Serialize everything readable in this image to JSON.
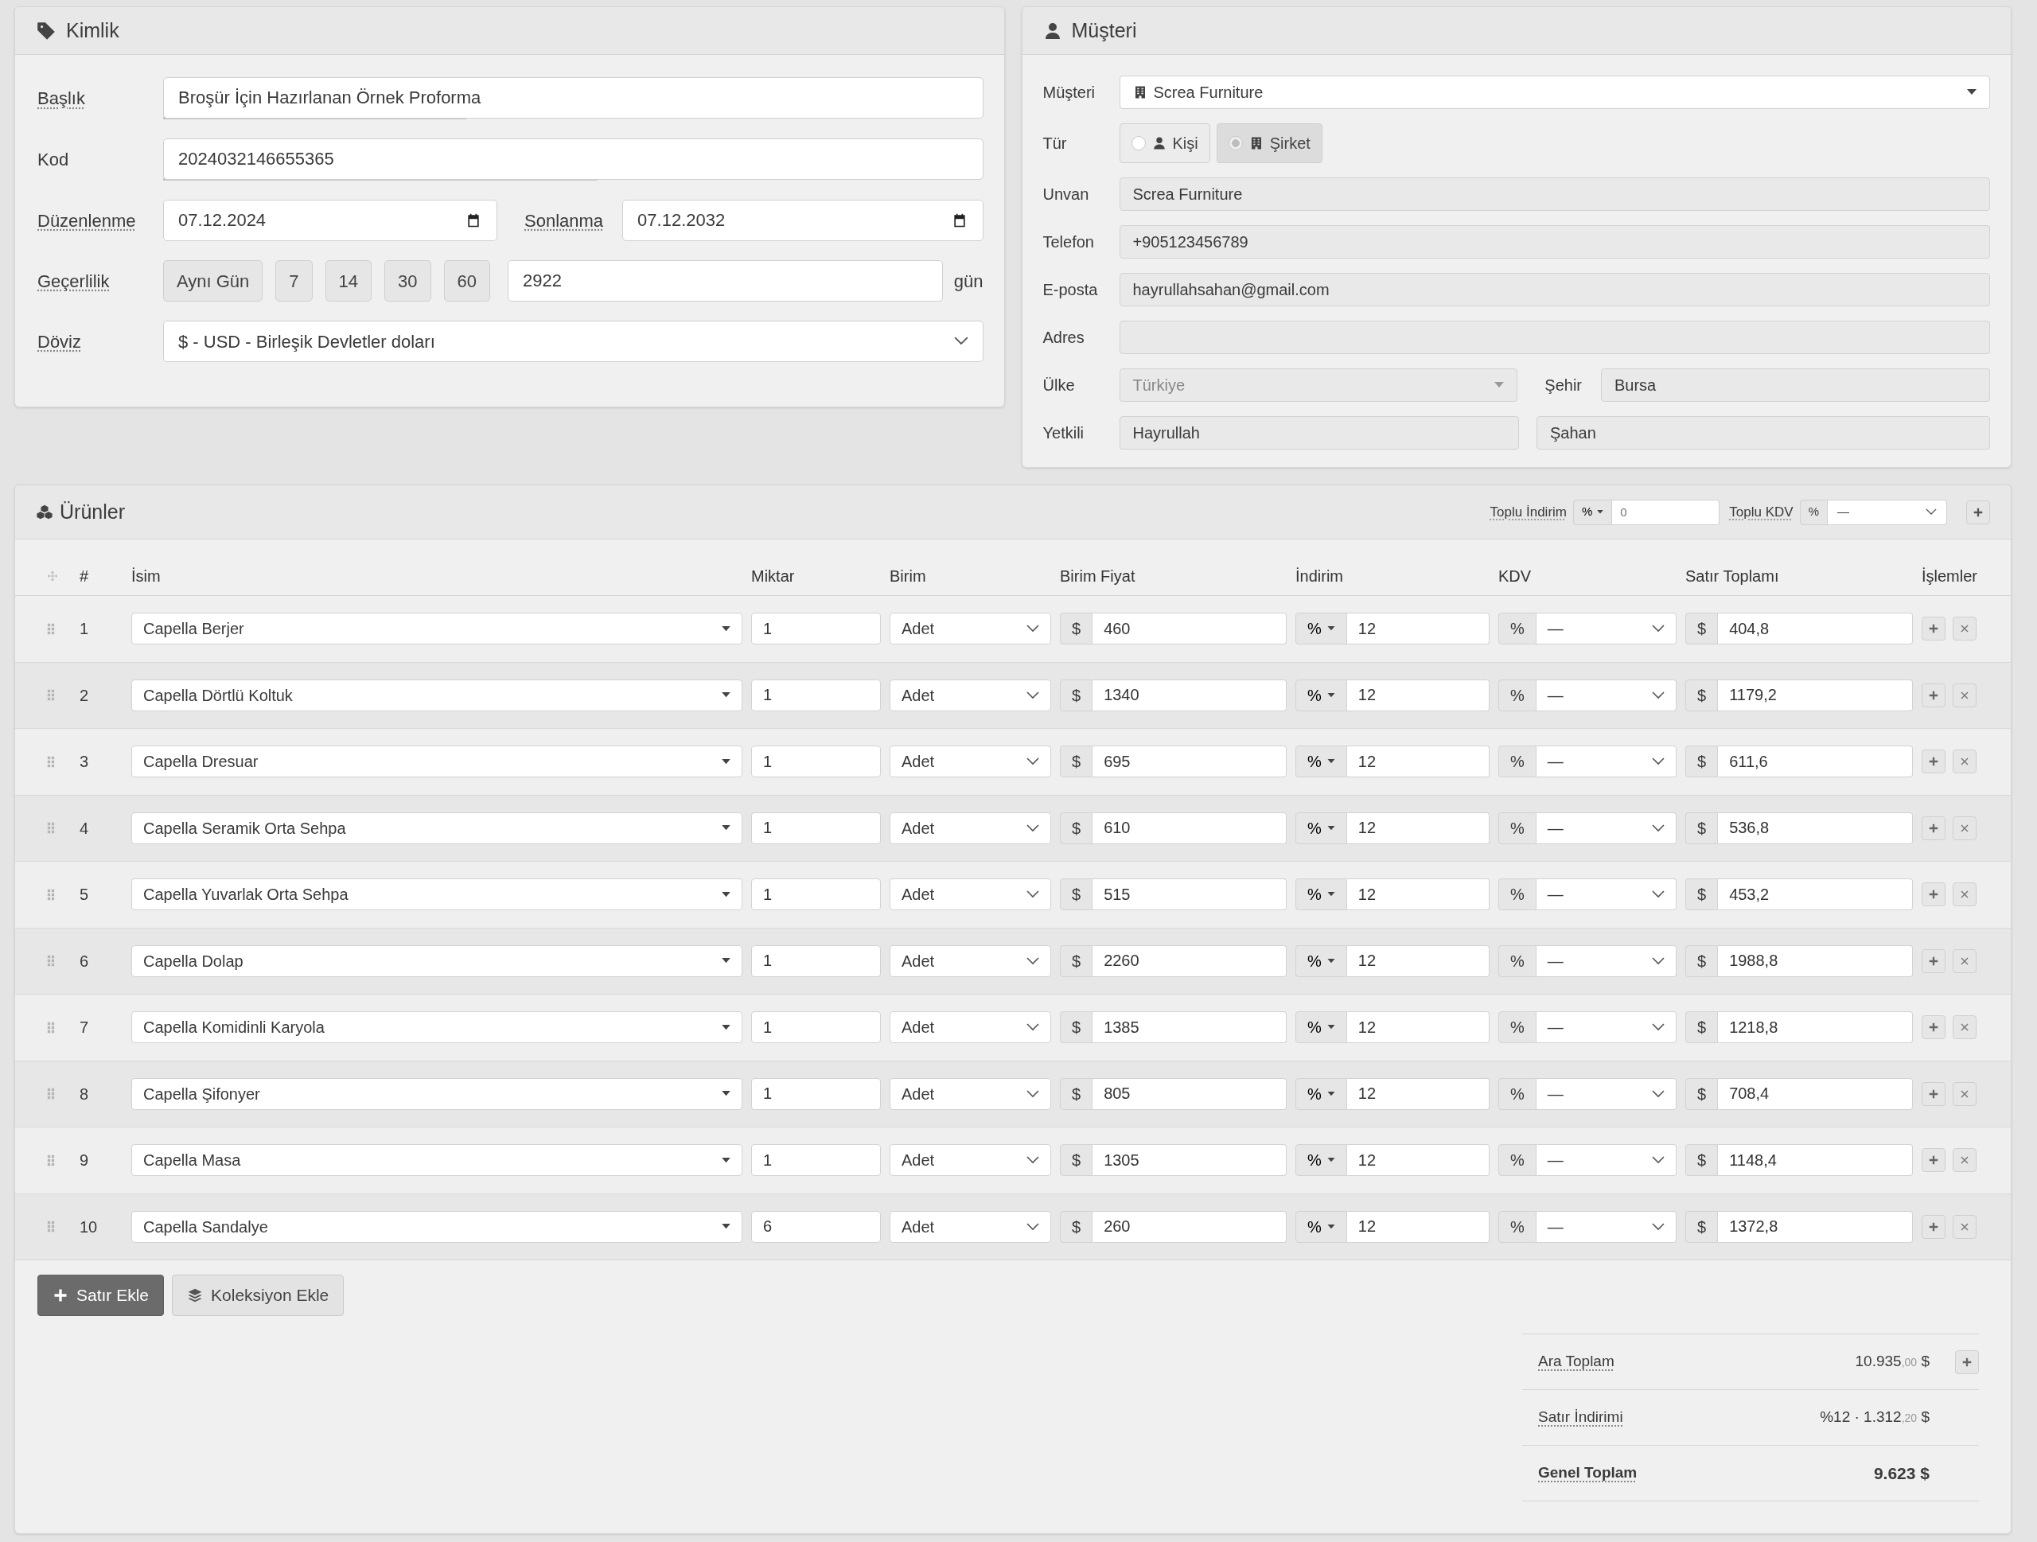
{
  "kimlik": {
    "title": "Kimlik",
    "title_field": {
      "label": "Başlık",
      "tooltip": true,
      "value": "Broşür İçin Hazırlanan Örnek Proforma",
      "level": 0.37
    },
    "code": {
      "label": "Kod",
      "tooltip": false,
      "value": "2024032146655365",
      "level": 0.53
    },
    "issue_date": {
      "label": "Düzenlenme",
      "tooltip": true,
      "value": "07.12.2024"
    },
    "expiry_date": {
      "label": "Sonlanma",
      "tooltip": true,
      "value": "07.12.2032"
    },
    "validity": {
      "label": "Geçerlilik",
      "tooltip": true,
      "presets": [
        "Aynı Gün",
        "7",
        "14",
        "30",
        "60"
      ],
      "value": "2922",
      "unit": "gün"
    },
    "currency": {
      "label": "Döviz",
      "tooltip": true,
      "value": "$ - USD - Birleşik Devletler doları"
    }
  },
  "customer": {
    "title": "Müşteri",
    "customer": {
      "label": "Müşteri",
      "value": "Screa Furniture"
    },
    "type": {
      "label": "Tür",
      "options": [
        {
          "label": "Kişi",
          "kind": "person",
          "selected": false
        },
        {
          "label": "Şirket",
          "kind": "company",
          "selected": true
        }
      ]
    },
    "fields": [
      {
        "label": "Unvan",
        "value": "Screa Furniture"
      },
      {
        "label": "Telefon",
        "value": "+905123456789"
      },
      {
        "label": "E-posta",
        "value": "hayrullahsahan@gmail.com"
      },
      {
        "label": "Adres"
      }
    ],
    "country": {
      "label": "Ülke",
      "value": "Türkiye"
    },
    "city": {
      "label": "Şehir",
      "value": "Bursa"
    },
    "contact": {
      "label": "Yetkili",
      "first_name": "Hayrullah",
      "last_name": "Şahan"
    }
  },
  "products": {
    "title": "Ürünler",
    "bulk_discount": {
      "label": "Toplu İndirim",
      "type": "%",
      "placeholder": "0"
    },
    "bulk_vat": {
      "label": "Toplu KDV",
      "unit": "%",
      "value": "—"
    },
    "columns": [
      "#",
      "İsim",
      "Miktar",
      "Birim",
      "Birim Fiyat",
      "İndirim",
      "KDV",
      "Satır Toplamı",
      "İşlemler"
    ],
    "rows": [
      {
        "no": "1",
        "name": "Capella Berjer",
        "qty": "1",
        "unit": "Adet",
        "currency": "$",
        "price": "460",
        "discount_type": "%",
        "discount": "12",
        "vat_unit": "%",
        "vat": "—",
        "total_currency": "$",
        "total": "404,8"
      },
      {
        "no": "2",
        "name": "Capella Dörtlü Koltuk",
        "qty": "1",
        "unit": "Adet",
        "currency": "$",
        "price": "1340",
        "discount_type": "%",
        "discount": "12",
        "vat_unit": "%",
        "vat": "—",
        "total_currency": "$",
        "total": "1179,2"
      },
      {
        "no": "3",
        "name": "Capella Dresuar",
        "qty": "1",
        "unit": "Adet",
        "currency": "$",
        "price": "695",
        "discount_type": "%",
        "discount": "12",
        "vat_unit": "%",
        "vat": "—",
        "total_currency": "$",
        "total": "611,6"
      },
      {
        "no": "4",
        "name": "Capella Seramik Orta Sehpa",
        "qty": "1",
        "unit": "Adet",
        "currency": "$",
        "price": "610",
        "discount_type": "%",
        "discount": "12",
        "vat_unit": "%",
        "vat": "—",
        "total_currency": "$",
        "total": "536,8"
      },
      {
        "no": "5",
        "name": "Capella Yuvarlak Orta Sehpa",
        "qty": "1",
        "unit": "Adet",
        "currency": "$",
        "price": "515",
        "discount_type": "%",
        "discount": "12",
        "vat_unit": "%",
        "vat": "—",
        "total_currency": "$",
        "total": "453,2"
      },
      {
        "no": "6",
        "name": "Capella Dolap",
        "qty": "1",
        "unit": "Adet",
        "currency": "$",
        "price": "2260",
        "discount_type": "%",
        "discount": "12",
        "vat_unit": "%",
        "vat": "—",
        "total_currency": "$",
        "total": "1988,8"
      },
      {
        "no": "7",
        "name": "Capella Komidinli Karyola",
        "qty": "1",
        "unit": "Adet",
        "currency": "$",
        "price": "1385",
        "discount_type": "%",
        "discount": "12",
        "vat_unit": "%",
        "vat": "—",
        "total_currency": "$",
        "total": "1218,8"
      },
      {
        "no": "8",
        "name": "Capella Şifonyer",
        "qty": "1",
        "unit": "Adet",
        "currency": "$",
        "price": "805",
        "discount_type": "%",
        "discount": "12",
        "vat_unit": "%",
        "vat": "—",
        "total_currency": "$",
        "total": "708,4"
      },
      {
        "no": "9",
        "name": "Capella Masa",
        "qty": "1",
        "unit": "Adet",
        "currency": "$",
        "price": "1305",
        "discount_type": "%",
        "discount": "12",
        "vat_unit": "%",
        "vat": "—",
        "total_currency": "$",
        "total": "1148,4"
      },
      {
        "no": "10",
        "name": "Capella Sandalye",
        "qty": "6",
        "unit": "Adet",
        "currency": "$",
        "price": "260",
        "discount_type": "%",
        "discount": "12",
        "vat_unit": "%",
        "vat": "—",
        "total_currency": "$",
        "total": "1372,8"
      }
    ],
    "buttons": [
      {
        "label": "Satır Ekle",
        "kind": "add-row"
      },
      {
        "label": "Koleksiyon Ekle",
        "kind": "collection"
      }
    ]
  },
  "summary": [
    {
      "label": "Ara Toplam",
      "kind": "subtotal",
      "amount": "10.935",
      "decimals": ",00",
      "currency": "$"
    },
    {
      "label": "Satır İndirimi",
      "kind": "discount",
      "rate": "%12",
      "separator": "·",
      "amount": "1.312",
      "decimals": ",20",
      "currency": "$"
    },
    {
      "label": "Genel Toplam",
      "kind": "total",
      "amount": "9.623",
      "currency": "$"
    }
  ]
}
